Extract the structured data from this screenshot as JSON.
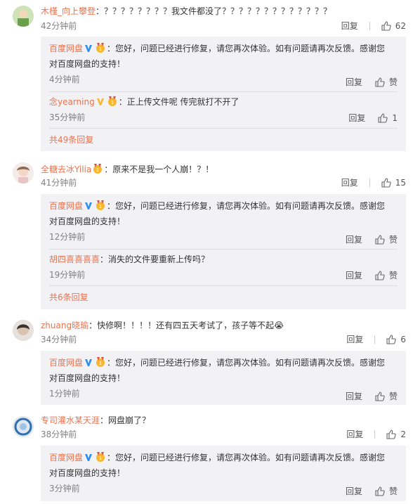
{
  "comments": [
    {
      "user": "木槿_向上攀登",
      "text": "：？？？？？？？？我文件都没了？？？？？？？？？？？？？",
      "time": "42分钟前",
      "reply_label": "回复",
      "likes": "62",
      "replies": [
        {
          "user": "百度网盘",
          "text": "：您好，问题已经进行修复，请您再次体验。如有问题请再次反馈。感谢您",
          "text2": "对百度网盘的支持！",
          "time": "4分钟前",
          "reply_label": "回复",
          "like_label": "赞"
        },
        {
          "user": "念yearning",
          "text": "：正上传文件呢 传完就打不开了",
          "time": "35分钟前",
          "reply_label": "回复",
          "like_label": "1"
        }
      ],
      "more": "共49条回复"
    },
    {
      "user": "全糖去冰Yilia",
      "text": "：原来不是我一个人崩！？！",
      "time": "41分钟前",
      "reply_label": "回复",
      "likes": "15",
      "replies": [
        {
          "user": "百度网盘",
          "text": "：您好，问题已经进行修复，请您再次体验。如有问题请再次反馈。感谢您",
          "text2": "对百度网盘的支持！",
          "time": "12分钟前",
          "reply_label": "回复",
          "like_label": "赞"
        },
        {
          "user": "胡四喜喜喜喜",
          "text": "：消失的文件要重新上传吗？",
          "time": "19分钟前",
          "reply_label": "回复",
          "like_label": "赞"
        }
      ],
      "more": "共6条回复"
    },
    {
      "user": "zhuang晓瑜",
      "text": "：快修啊！！！！还有四五天考试了，孩子等不起",
      "emoji": "😭",
      "time": "34分钟前",
      "reply_label": "回复",
      "likes": "6",
      "replies": [
        {
          "user": "百度网盘",
          "text": "：您好，问题已经进行修复，请您再次体验。如有问题请再次反馈。感谢您",
          "text2": "对百度网盘的支持！",
          "time": "1分钟前",
          "reply_label": "回复",
          "like_label": "赞"
        }
      ]
    },
    {
      "user": "专司灌水某天涯",
      "text": "：网盘崩了？",
      "time": "38分钟前",
      "reply_label": "回复",
      "likes": "2",
      "replies": [
        {
          "user": "百度网盘",
          "text": "：您好，问题已经进行修复，请您再次体验。如有问题请再次反馈。感谢您",
          "text2": "对百度网盘的支持！",
          "time": "3分钟前",
          "reply_label": "回复",
          "like_label": "赞"
        }
      ]
    }
  ],
  "colors": {
    "username": "#eb7350",
    "reply_box": "#f2f2f5",
    "verified": "#2b8ff0"
  }
}
